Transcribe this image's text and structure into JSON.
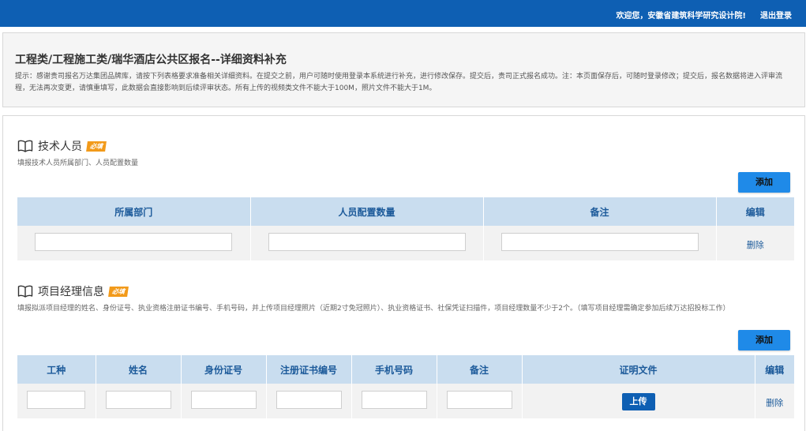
{
  "topbar": {
    "welcome": "欢迎您，安徽省建筑科学研究设计院!",
    "logout": "退出登录"
  },
  "header": {
    "title": "工程类/工程施工类/瑞华酒店公共区报名--详细资料补充",
    "tip": "提示：感谢贵司报名万达集团品牌库，请按下列表格要求准备相关详细资料。在提交之前，用户可随时使用登录本系统进行补充，进行修改保存。提交后，贵司正式报名成功。注：本页面保存后，可随时登录修改；提交后，报名数据将进入评审流程，无法再次变更，请慎重填写，此数据会直接影响到后续评审状态。所有上传的视频类文件不能大于100M，照片文件不能大于1M。"
  },
  "sections": {
    "tech": {
      "title": "技术人员",
      "badge": "必填",
      "desc": "填报技术人员所属部门、人员配置数量",
      "add_label": "添加",
      "columns": [
        "所属部门",
        "人员配置数量",
        "备注",
        "编辑"
      ],
      "row_action": "删除"
    },
    "pm": {
      "title": "项目经理信息",
      "badge": "必填",
      "desc": "填报拟派项目经理的姓名、身份证号、执业资格注册证书编号、手机号码，并上传项目经理照片（近期2寸免冠照片）、执业资格证书、社保凭证扫描件，项目经理数量不少于2个。（填写项目经理需确定参加后续万达招投标工作）",
      "add_label": "添加",
      "columns": [
        "工种",
        "姓名",
        "身份证号",
        "注册证书编号",
        "手机号码",
        "备注",
        "证明文件",
        "编辑"
      ],
      "upload_label": "上传",
      "row_action": "删除"
    }
  },
  "colors": {
    "topbar": "#0e5fb3",
    "table_header_bg": "#c9ddef",
    "table_header_text": "#1c5a9a",
    "add_button": "#1f8ae8",
    "badge": "#f29a1a"
  },
  "icons": {
    "section": "book-open-icon"
  }
}
